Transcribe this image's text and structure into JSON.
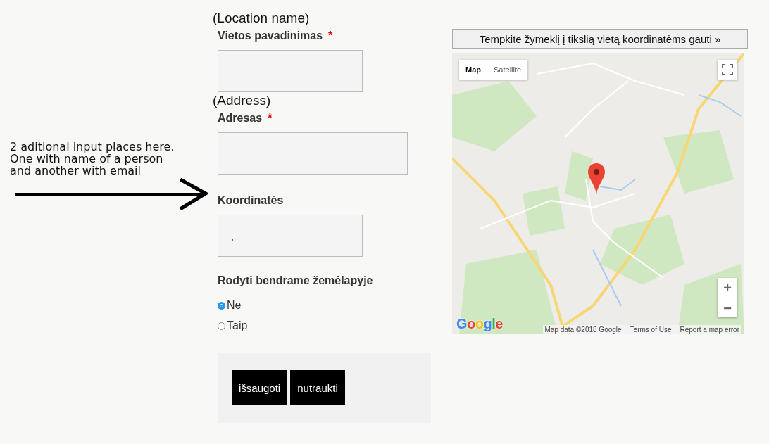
{
  "annotation": {
    "text": "2 aditional input places here.\nOne with name of a person\nand another with email"
  },
  "fields": [
    {
      "note": "(Location name)",
      "label": "Vietos pavadinimas",
      "required_mark": "*"
    },
    {
      "note": "(Address)",
      "label": "Adresas",
      "required_mark": "*"
    },
    {
      "label": "Koordinatės",
      "value": ","
    }
  ],
  "visibility": {
    "label": "Rodyti bendrame žemėlapyje",
    "options": [
      {
        "label": "Ne",
        "selected": true
      },
      {
        "label": "Taip",
        "selected": false
      }
    ]
  },
  "buttons": [
    "išsaugoti",
    "nutraukti"
  ],
  "map": {
    "button": "Tempkite žymeklį į tikslią vietą koordinatėms gauti »",
    "type_controls": [
      {
        "label": "Map",
        "selected": true
      },
      {
        "label": "Satellite",
        "selected": false
      }
    ],
    "zoom_controls": [
      "+",
      "−"
    ],
    "logo": "Google",
    "attribution": [
      "Map data ©2018 Google",
      "Terms of Use",
      "Report a map error"
    ]
  }
}
